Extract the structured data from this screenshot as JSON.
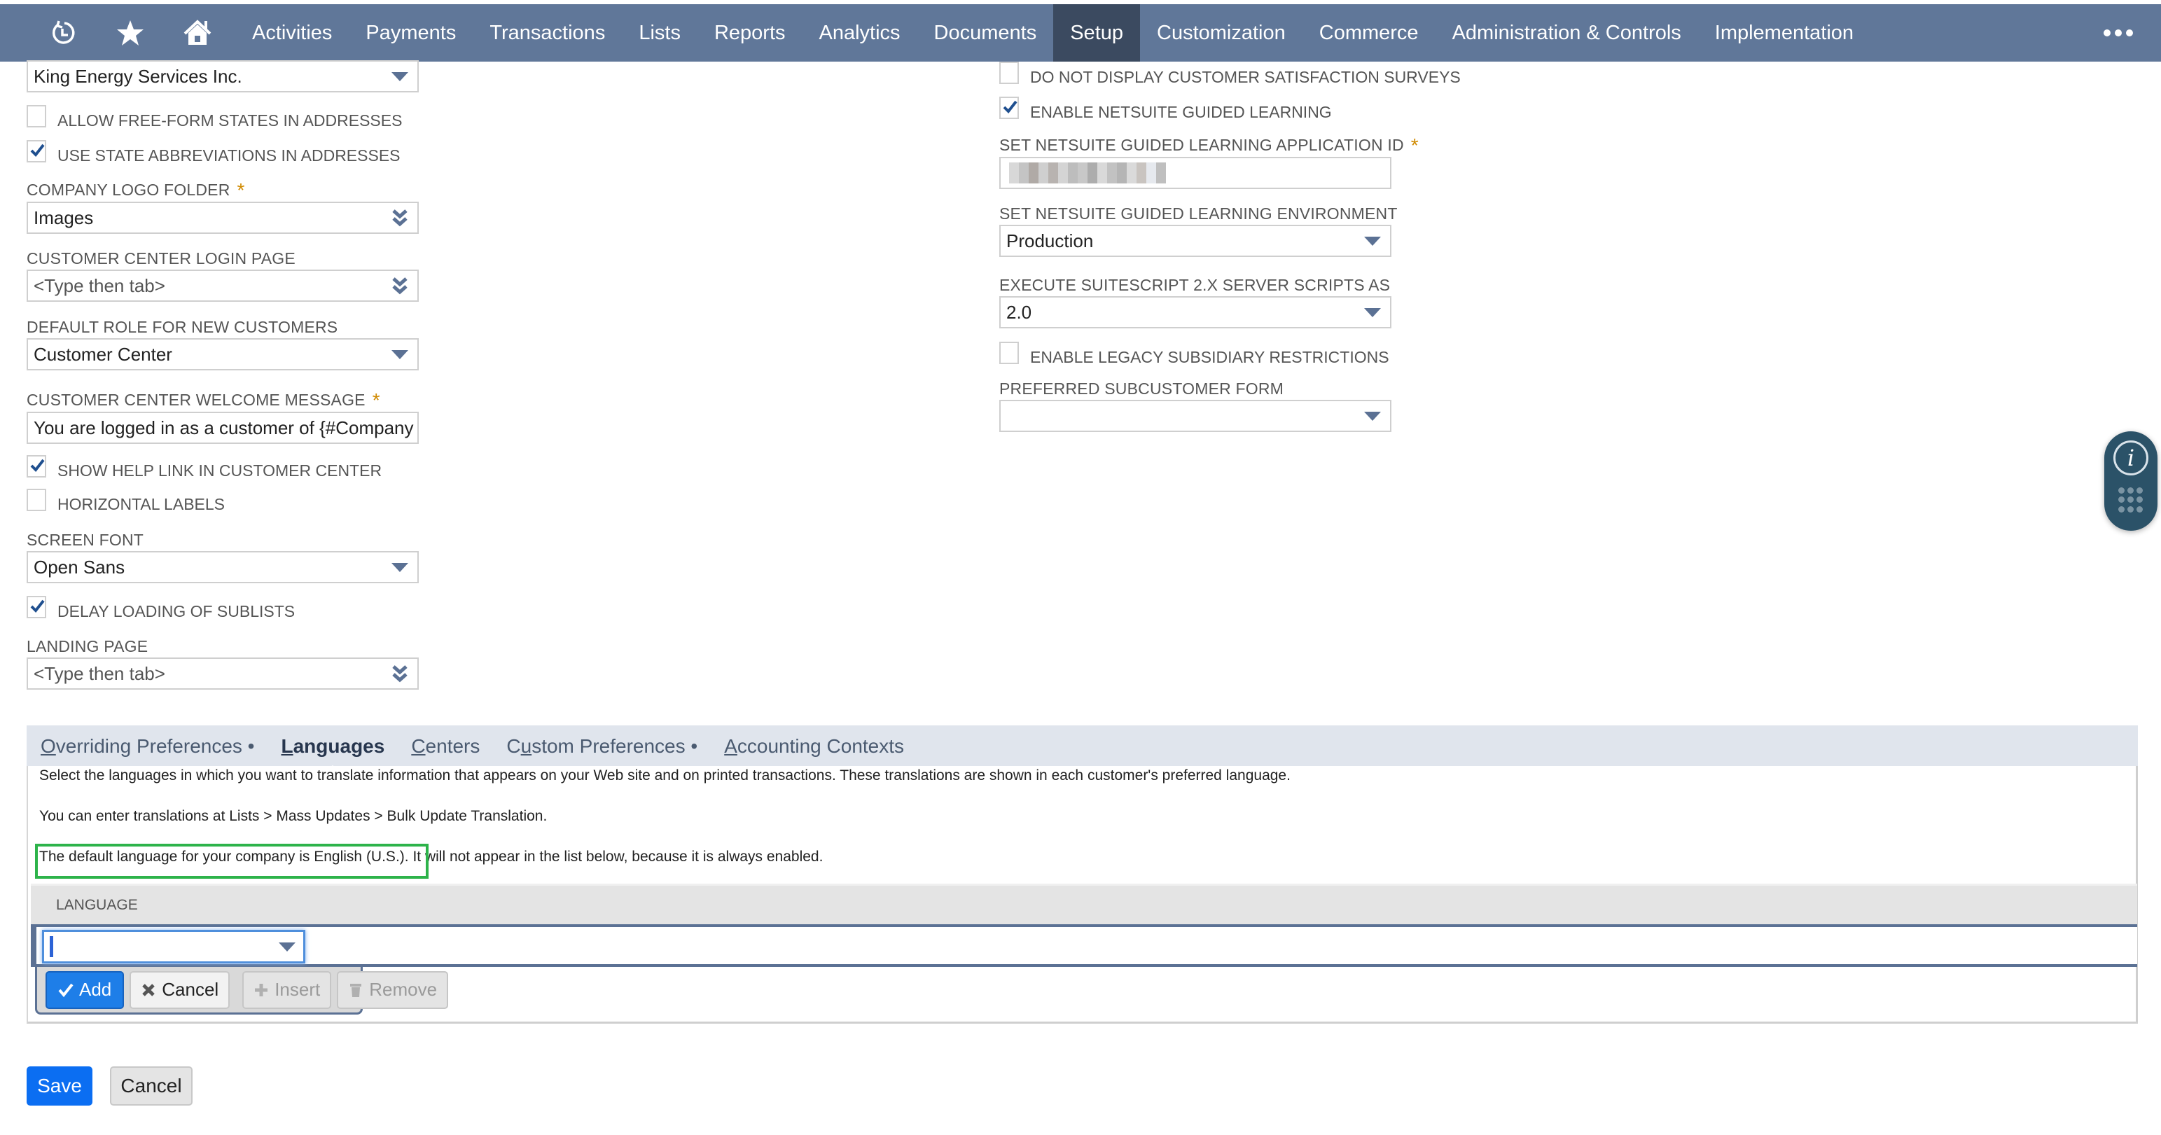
{
  "nav": {
    "icons": [
      "recent-records-icon",
      "favorites-star-icon",
      "home-icon"
    ],
    "items": [
      {
        "label": "Activities",
        "active": false
      },
      {
        "label": "Payments",
        "active": false
      },
      {
        "label": "Transactions",
        "active": false
      },
      {
        "label": "Lists",
        "active": false
      },
      {
        "label": "Reports",
        "active": false
      },
      {
        "label": "Analytics",
        "active": false
      },
      {
        "label": "Documents",
        "active": false
      },
      {
        "label": "Setup",
        "active": true
      },
      {
        "label": "Customization",
        "active": false
      },
      {
        "label": "Commerce",
        "active": false
      },
      {
        "label": "Administration & Controls",
        "active": false
      },
      {
        "label": "Implementation",
        "active": false
      }
    ],
    "more_icon": "ellipsis-icon"
  },
  "left_fields": {
    "subsidiary": {
      "value": "King Energy Services Inc."
    },
    "allow_free_form_states": {
      "label": "Allow Free-Form States in Addresses",
      "checked": false
    },
    "use_state_abbreviations": {
      "label": "Use State Abbreviations in Addresses",
      "checked": true
    },
    "company_logo_folder": {
      "label": "Company Logo Folder",
      "required": true,
      "value": "Images"
    },
    "customer_center_login_page": {
      "label": "Customer Center Login Page",
      "placeholder": "<Type then tab>"
    },
    "default_role_new_customers": {
      "label": "Default Role for New Customers",
      "value": "Customer Center"
    },
    "customer_center_welcome_message": {
      "label": "Customer Center Welcome Message",
      "required": true,
      "value": "You are logged in as a customer of {#Company"
    },
    "show_help_link": {
      "label": "Show Help Link in Customer Center",
      "checked": true
    },
    "horizontal_labels": {
      "label": "Horizontal Labels",
      "checked": false
    },
    "screen_font": {
      "label": "Screen Font",
      "value": "Open Sans"
    },
    "delay_loading_sublists": {
      "label": "Delay Loading of Sublists",
      "checked": true
    },
    "landing_page": {
      "label": "Landing Page",
      "placeholder": "<Type then tab>"
    }
  },
  "right_fields": {
    "no_satisfaction_surveys": {
      "label": "Do Not Display Customer Satisfaction Surveys",
      "checked": false
    },
    "enable_guided_learning": {
      "label": "Enable NetSuite Guided Learning",
      "checked": true
    },
    "guided_learning_app_id": {
      "label": "Set NetSuite Guided Learning Application ID",
      "required": true,
      "value_redacted": true
    },
    "guided_learning_environment": {
      "label": "Set NetSuite Guided Learning Environment",
      "value": "Production"
    },
    "suitescript_server_version": {
      "label": "Execute SuiteScript 2.x Server Scripts As",
      "value": "2.0"
    },
    "legacy_subsidiary_restrictions": {
      "label": "Enable Legacy Subsidiary Restrictions",
      "checked": false
    },
    "preferred_subcustomer_form": {
      "label": "Preferred Subcustomer Form",
      "value": ""
    }
  },
  "subtabs": {
    "items": [
      {
        "label": "Overriding Preferences",
        "access_key": "O",
        "rest": "verriding Preferences",
        "dot": true,
        "active": false
      },
      {
        "label": "Languages",
        "access_key": "L",
        "rest": "anguages",
        "dot": false,
        "active": true
      },
      {
        "label": "Centers",
        "access_key": "C",
        "rest": "enters",
        "dot": false,
        "active": false
      },
      {
        "label": "Custom Preferences",
        "access_key_pre": "C",
        "access_key": "u",
        "rest": "stom Preferences",
        "dot": true,
        "active": false
      },
      {
        "label": "Accounting Contexts",
        "access_key": "A",
        "rest": "ccounting Contexts",
        "dot": false,
        "active": false
      }
    ],
    "dot_char": " •"
  },
  "languages_panel": {
    "help_line_1": "Select the languages in which you want to translate information that appears on your Web site and on printed transactions. These translations are shown in each customer's preferred language.",
    "help_line_2": "You can enter translations at Lists > Mass Updates > Bulk Update Translation.",
    "help_line_3_highlighted": "The default language for your company is English (U.S.).",
    "help_line_3_rest": " It will not appear in the list below, because it is always enabled.",
    "column_header": "LANGUAGE",
    "language_select_value": "",
    "buttons": {
      "add": "Add",
      "cancel": "Cancel",
      "insert": "Insert",
      "remove": "Remove"
    }
  },
  "footer": {
    "save": "Save",
    "cancel": "Cancel"
  },
  "help_widget": {
    "info_glyph": "i"
  },
  "colors": {
    "nav_bg": "#607799",
    "nav_active": "#3b4a60",
    "required_star": "#d08a00",
    "primary_button": "#0b6ef2",
    "highlight_box": "#2db34a",
    "checkmark": "#1f4f8f"
  }
}
